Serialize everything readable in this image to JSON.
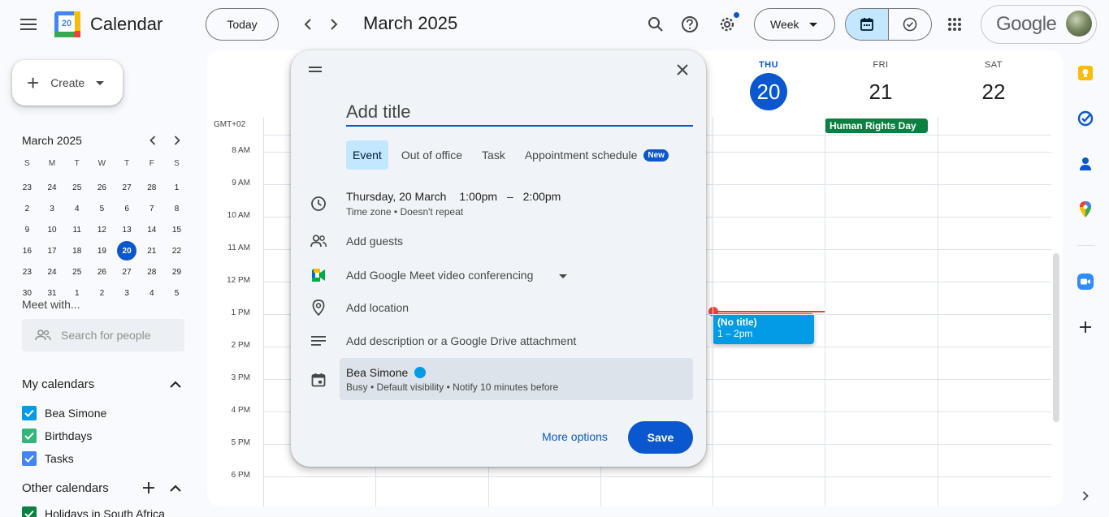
{
  "header": {
    "app_title": "Calendar",
    "logo_day": "20",
    "today_label": "Today",
    "month_title": "March 2025",
    "view_label": "Week",
    "account_brand": "Google",
    "icons": [
      "main-menu-icon",
      "search-icon",
      "help-icon",
      "settings-icon",
      "calendar-view-icon",
      "tasks-view-icon",
      "apps-grid-icon"
    ]
  },
  "sidebar": {
    "create_label": "Create",
    "mini_cal": {
      "title": "March 2025",
      "dow": [
        "S",
        "M",
        "T",
        "W",
        "T",
        "F",
        "S"
      ],
      "weeks": [
        [
          "23",
          "24",
          "25",
          "26",
          "27",
          "28",
          "1"
        ],
        [
          "2",
          "3",
          "4",
          "5",
          "6",
          "7",
          "8"
        ],
        [
          "9",
          "10",
          "11",
          "12",
          "13",
          "14",
          "15"
        ],
        [
          "16",
          "17",
          "18",
          "19",
          "20",
          "21",
          "22"
        ],
        [
          "23",
          "24",
          "25",
          "26",
          "27",
          "28",
          "29"
        ],
        [
          "30",
          "31",
          "1",
          "2",
          "3",
          "4",
          "5"
        ]
      ],
      "selected_day": "20"
    },
    "meet_with": "Meet with...",
    "search_people_placeholder": "Search for people",
    "my_calendars_title": "My calendars",
    "my_calendars": [
      {
        "label": "Bea Simone",
        "color": "#039be5"
      },
      {
        "label": "Birthdays",
        "color": "#33b679"
      },
      {
        "label": "Tasks",
        "color": "#4285f4"
      }
    ],
    "other_calendars_title": "Other calendars",
    "other_calendars": [
      {
        "label": "Holidays in South Africa",
        "color": "#0b8043"
      }
    ]
  },
  "grid": {
    "timezone": "GMT+02",
    "days": [
      {
        "name": "THU",
        "num": "20",
        "today": true
      },
      {
        "name": "FRI",
        "num": "21",
        "today": false
      },
      {
        "name": "SAT",
        "num": "22",
        "today": false
      }
    ],
    "hours": [
      "8 AM",
      "9 AM",
      "10 AM",
      "11 AM",
      "12 PM",
      "1 PM",
      "2 PM",
      "3 PM",
      "4 PM",
      "5 PM",
      "6 PM"
    ],
    "holiday": "Human Rights Day",
    "event": {
      "title": "(No title)",
      "time": "1 – 2pm"
    }
  },
  "dialog": {
    "title_placeholder": "Add title",
    "tabs": [
      "Event",
      "Out of office",
      "Task",
      "Appointment schedule"
    ],
    "new_badge": "New",
    "when_date": "Thursday, 20 March",
    "when_start": "1:00pm",
    "when_dash": "–",
    "when_end": "2:00pm",
    "when_sub": "Time zone • Doesn't repeat",
    "add_guests": "Add guests",
    "add_meet": "Add Google Meet video conferencing",
    "add_location": "Add location",
    "add_description": "Add description or a Google Drive attachment",
    "owner_name": "Bea Simone",
    "owner_sub": "Busy • Default visibility • Notify 10 minutes before",
    "more_options": "More options",
    "save": "Save"
  }
}
